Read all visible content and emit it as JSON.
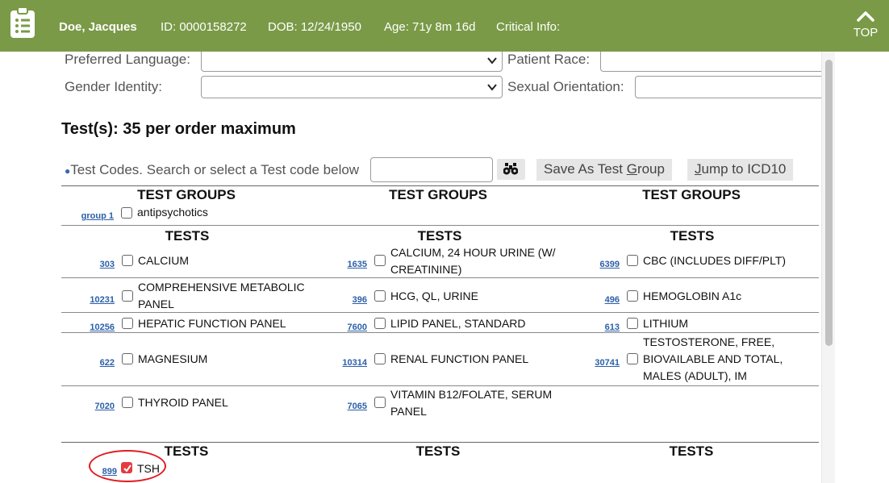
{
  "header": {
    "name": "Doe, Jacques",
    "id": "ID: 0000158272",
    "dob": "DOB: 12/24/1950",
    "age": "Age: 71y 8m 16d",
    "critical": "Critical Info:",
    "top_label": "TOP"
  },
  "demographics": {
    "preferred_language": "Preferred Language:",
    "patient_race": "Patient Race:",
    "gender_identity": "Gender Identity:",
    "sexual_orientation": "Sexual Orientation:"
  },
  "tests_title": "Test(s): 35 per order maximum",
  "search": {
    "label": "Test Codes. Search or select a Test code below",
    "placeholder": "",
    "save_group_pre": "Save As Test ",
    "save_group_key": "G",
    "save_group_post": "roup",
    "jump_key": "J",
    "jump_post": "ump to ICD10"
  },
  "headings": {
    "test_groups": "TEST GROUPS",
    "tests": "TESTS"
  },
  "groups": [
    {
      "code": "group 1",
      "name": "antipsychotics",
      "checked": false
    }
  ],
  "tests": [
    {
      "code": "303",
      "name": "CALCIUM",
      "checked": false
    },
    {
      "code": "1635",
      "name": "CALCIUM, 24 HOUR URINE (W/",
      "name2": "CREATININE)",
      "checked": false
    },
    {
      "code": "6399",
      "name": "CBC (INCLUDES DIFF/PLT)",
      "checked": false
    },
    {
      "code": "10231",
      "name": "COMPREHENSIVE METABOLIC",
      "name2": "PANEL",
      "checked": false
    },
    {
      "code": "396",
      "name": "HCG, QL, URINE",
      "checked": false
    },
    {
      "code": "496",
      "name": "HEMOGLOBIN A1c",
      "checked": false
    },
    {
      "code": "10256",
      "name": "HEPATIC FUNCTION PANEL",
      "checked": false
    },
    {
      "code": "7600",
      "name": "LIPID PANEL, STANDARD",
      "checked": false
    },
    {
      "code": "613",
      "name": "LITHIUM",
      "checked": false
    },
    {
      "code": "622",
      "name": "MAGNESIUM",
      "checked": false
    },
    {
      "code": "10314",
      "name": "RENAL FUNCTION PANEL",
      "checked": false
    },
    {
      "code": "30741",
      "name": "TESTOSTERONE, FREE,",
      "name2": "BIOVAILABLE AND TOTAL,",
      "name3": "MALES (ADULT), IM",
      "checked": false
    },
    {
      "code": "7020",
      "name": "THYROID PANEL",
      "checked": false
    },
    {
      "code": "7065",
      "name": "VITAMIN B12/FOLATE, SERUM",
      "name2": "PANEL",
      "checked": false
    }
  ],
  "selected_tests": [
    {
      "code": "899",
      "name": "TSH",
      "checked": true
    }
  ],
  "colors": {
    "header_bg": "#7a9a47",
    "link": "#2b5fa8",
    "checked": "#e53b3f",
    "highlight_oval": "#e01b22"
  }
}
